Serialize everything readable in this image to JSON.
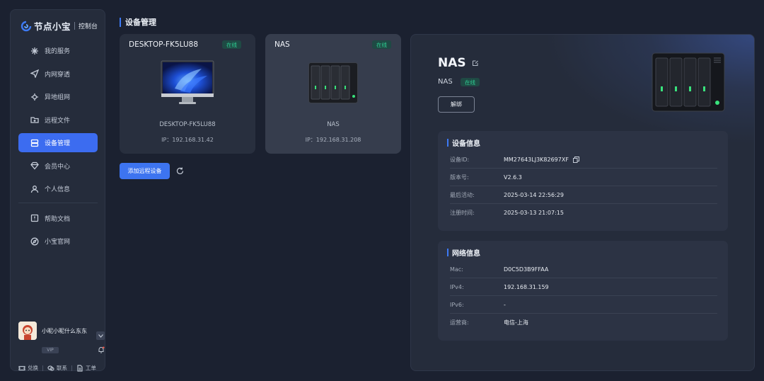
{
  "app": {
    "brand": "节点小宝",
    "console": "控制台",
    "accent": "#3c6cf0"
  },
  "sidebar": {
    "items": [
      {
        "label": "我的服务",
        "icon": "sparkle-icon"
      },
      {
        "label": "内网穿透",
        "icon": "send-icon"
      },
      {
        "label": "异地组网",
        "icon": "network-icon"
      },
      {
        "label": "远程文件",
        "icon": "folder-icon"
      },
      {
        "label": "设备管理",
        "icon": "device-icon",
        "active": true
      },
      {
        "label": "会员中心",
        "icon": "diamond-icon"
      },
      {
        "label": "个人信息",
        "icon": "user-icon"
      },
      {
        "label": "帮助文档",
        "icon": "help-icon"
      },
      {
        "label": "小宝官网",
        "icon": "compass-icon"
      }
    ],
    "user": {
      "name": "小昵小昵什么东东",
      "vip": "VIP"
    },
    "bottom_links": [
      {
        "label": "兑换",
        "icon": "ticket-icon"
      },
      {
        "label": "联系",
        "icon": "chat-icon"
      },
      {
        "label": "工单",
        "icon": "doc-icon"
      }
    ]
  },
  "page": {
    "title": "设备管理"
  },
  "devices": [
    {
      "name": "DESKTOP-FK5LU88",
      "status": "在线",
      "display_name": "DESKTOP-FK5LU88",
      "ip": "IP：192.168.31.42"
    },
    {
      "name": "NAS",
      "status": "在线",
      "display_name": "NAS",
      "ip": "IP：192.168.31.208"
    }
  ],
  "actions": {
    "add_remote": "添加远程设备"
  },
  "detail": {
    "title": "NAS",
    "subtitle": "NAS",
    "status": "在线",
    "unbind": "解绑",
    "device_info": {
      "heading": "设备信息",
      "rows": [
        {
          "k": "设备ID:",
          "v": "MM27643LJ3K82697XF"
        },
        {
          "k": "版本号:",
          "v": "V2.6.3"
        },
        {
          "k": "最后活动:",
          "v": "2025-03-14 22:56:29"
        },
        {
          "k": "注册时间:",
          "v": "2025-03-13 21:07:15"
        }
      ]
    },
    "network_info": {
      "heading": "网络信息",
      "rows": [
        {
          "k": "Mac:",
          "v": "D0C5D3B9FFAA"
        },
        {
          "k": "IPv4:",
          "v": "192.168.31.159"
        },
        {
          "k": "IPv6:",
          "v": "-"
        },
        {
          "k": "运营商:",
          "v": "电信-上海"
        }
      ]
    }
  }
}
